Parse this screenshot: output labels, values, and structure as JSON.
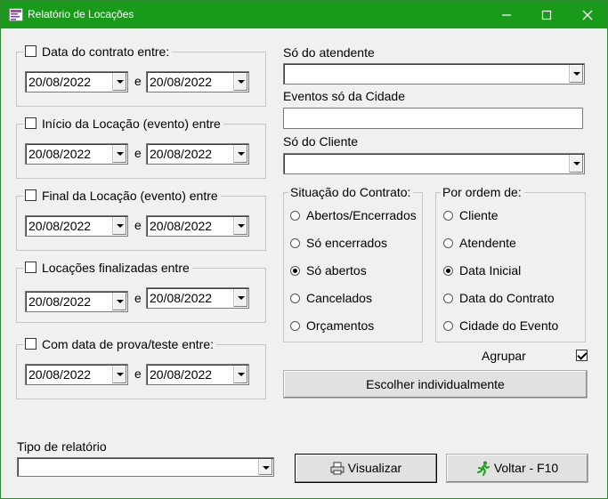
{
  "window": {
    "title": "Relatório de Locações",
    "minimize_icon": "minimize-icon",
    "maximize_icon": "maximize-icon",
    "close_icon": "close-icon"
  },
  "date_filters": {
    "separator": "e",
    "groups": [
      {
        "label": "Data do contrato entre:",
        "checked": false,
        "from": "20/08/2022",
        "to": "20/08/2022"
      },
      {
        "label": "Início da Locação (evento) entre",
        "checked": false,
        "from": "20/08/2022",
        "to": "20/08/2022"
      },
      {
        "label": "Final da Locação (evento) entre",
        "checked": false,
        "from": "20/08/2022",
        "to": "20/08/2022"
      },
      {
        "label": "Locações finalizadas entre",
        "checked": false,
        "from": "20/08/2022",
        "to": "20/08/2022"
      },
      {
        "label": "Com data de prova/teste entre:",
        "checked": false,
        "from": "20/08/2022",
        "to": "20/08/2022"
      }
    ]
  },
  "filters": {
    "atendente_label": "Só do atendente",
    "atendente_value": "",
    "cidade_label": "Eventos só da Cidade",
    "cidade_value": "",
    "cliente_label": "Só do Cliente",
    "cliente_value": ""
  },
  "situacao": {
    "label": "Situação do Contrato:",
    "options": [
      "Abertos/Encerrados",
      "Só encerrados",
      "Só abertos",
      "Cancelados",
      "Orçamentos"
    ],
    "selected": "Só abertos"
  },
  "ordem": {
    "label": "Por ordem de:",
    "options": [
      "Cliente",
      "Atendente",
      "Data Inicial",
      "Data do Contrato",
      "Cidade do Evento"
    ],
    "selected": "Data Inicial"
  },
  "agrupar": {
    "label": "Agrupar",
    "checked": true
  },
  "escolher_button": "Escolher individualmente",
  "tipo": {
    "label": "Tipo de relatório",
    "value": ""
  },
  "visualizar_button": {
    "label": "Visualizar",
    "icon": "printer-icon"
  },
  "voltar_button": {
    "label": "Voltar - F10",
    "icon": "running-man-icon"
  },
  "colors": {
    "titlebar": "#1a9a1a",
    "window_bg": "#f0f0f0",
    "voltar_icon": "#1f9e1f"
  }
}
